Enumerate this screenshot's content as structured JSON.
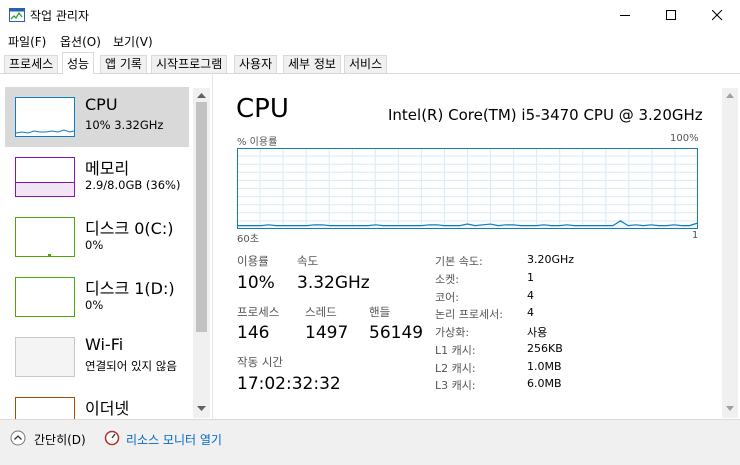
{
  "window": {
    "title": "작업 관리자",
    "minimize_icon": "minimize-icon",
    "maximize_icon": "maximize-icon",
    "close_icon": "close-icon"
  },
  "menu": [
    "파일(F)",
    "옵션(O)",
    "보기(V)"
  ],
  "tabs": [
    "프로세스",
    "성능",
    "앱 기록",
    "시작프로그램",
    "사용자",
    "세부 정보",
    "서비스"
  ],
  "active_tab": "성능",
  "sidebar": {
    "items": [
      {
        "title": "CPU",
        "sub": "10% 3.32GHz",
        "color": "#117dbb"
      },
      {
        "title": "메모리",
        "sub": "2.9/8.0GB (36%)",
        "color": "#8b12ae"
      },
      {
        "title": "디스크 0(C:)",
        "sub": "0%",
        "color": "#4da60c"
      },
      {
        "title": "디스크 1(D:)",
        "sub": "0%",
        "color": "#4da60c"
      },
      {
        "title": "Wi-Fi",
        "sub": "연결되어 있지 않음",
        "color": "#a0a0a0"
      },
      {
        "title": "이더넷",
        "sub": "",
        "color": "#a74f01"
      }
    ]
  },
  "cpu": {
    "heading": "CPU",
    "model": "Intel(R) Core(TM) i5-3470 CPU @ 3.20GHz",
    "util_label": "% 이용률",
    "max_label": "100%",
    "time_left": "60초",
    "time_right": "1",
    "graph_color": "#117dbb",
    "utilization_history": [
      3,
      3,
      3,
      3,
      4,
      3,
      3,
      3,
      3,
      3,
      4,
      4,
      3,
      3,
      3,
      3,
      3,
      3,
      4,
      3,
      3,
      3,
      3,
      3,
      3,
      4,
      4,
      3,
      3,
      3,
      5,
      3,
      4,
      5,
      3,
      4,
      4,
      3,
      3,
      3,
      4,
      3,
      3,
      4,
      3,
      3,
      3,
      3,
      3,
      3,
      9,
      3,
      4,
      3,
      4,
      3,
      3,
      4,
      3,
      3,
      6
    ]
  },
  "stats": {
    "utilization": {
      "label": "이용률",
      "value": "10%"
    },
    "speed": {
      "label": "속도",
      "value": "3.32GHz"
    },
    "processes": {
      "label": "프로세스",
      "value": "146"
    },
    "threads": {
      "label": "스레드",
      "value": "1497"
    },
    "handles": {
      "label": "핸들",
      "value": "56149"
    },
    "uptime": {
      "label": "작동 시간",
      "value": "17:02:32:32"
    }
  },
  "specs": [
    {
      "label": "기본 속도:",
      "value": "3.20GHz"
    },
    {
      "label": "소켓:",
      "value": "1"
    },
    {
      "label": "코어:",
      "value": "4"
    },
    {
      "label": "논리 프로세서:",
      "value": "4"
    },
    {
      "label": "가상화:",
      "value": "사용"
    },
    {
      "label": "L1 캐시:",
      "value": "256KB"
    },
    {
      "label": "L2 캐시:",
      "value": "1.0MB"
    },
    {
      "label": "L3 캐시:",
      "value": "6.0MB"
    }
  ],
  "footer": {
    "collapse": "간단히(D)",
    "resource_monitor": "리소스 모니터 열기"
  }
}
